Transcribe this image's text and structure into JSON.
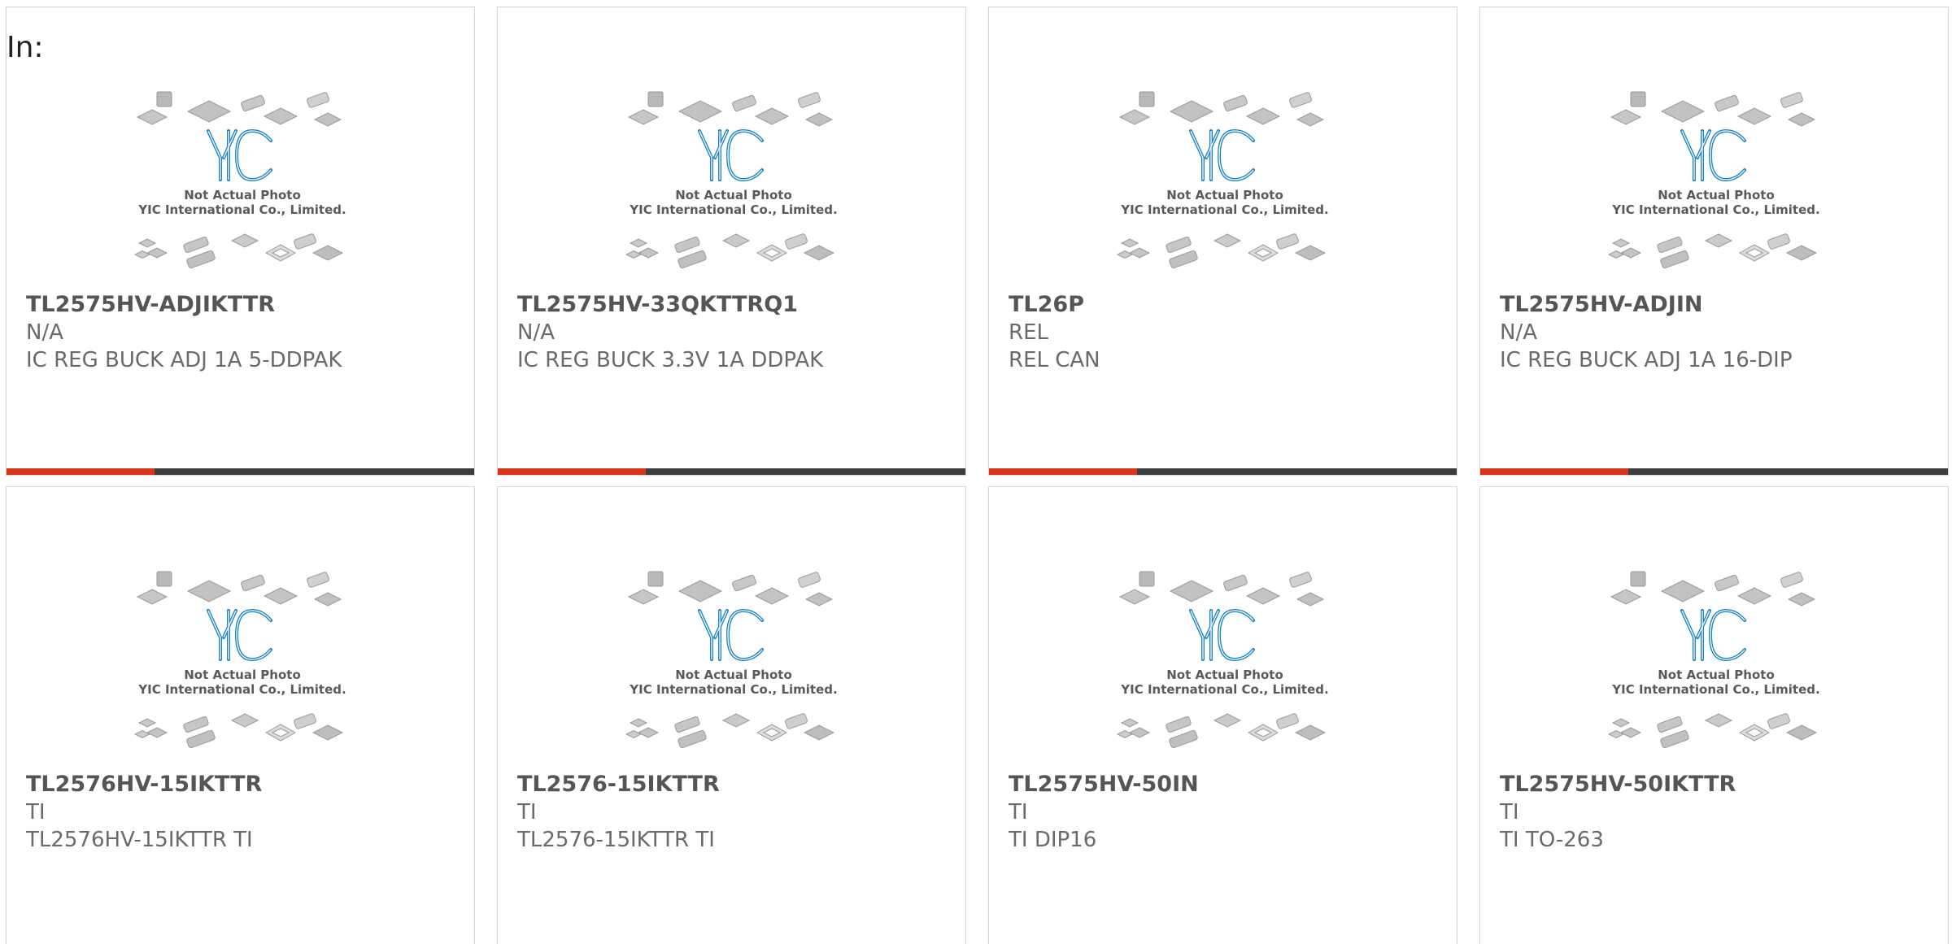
{
  "header": {
    "prefix": "In:"
  },
  "colors": {
    "accent": "#d9331a",
    "bar": "#3d3d3d",
    "logo": "#1a86c8"
  },
  "photo": {
    "caption_line1": "Not Actual Photo",
    "caption_line2": "YIC International Co., Limited."
  },
  "products": [
    {
      "part": "TL2575HV-ADJIKTTR",
      "mfr": "N/A",
      "desc": "IC REG BUCK ADJ 1A 5-DDPAK"
    },
    {
      "part": "TL2575HV-33QKTTRQ1",
      "mfr": "N/A",
      "desc": "IC REG BUCK 3.3V 1A DDPAK"
    },
    {
      "part": "TL26P",
      "mfr": "REL",
      "desc": "REL CAN"
    },
    {
      "part": "TL2575HV-ADJIN",
      "mfr": "N/A",
      "desc": "IC REG BUCK ADJ 1A 16-DIP"
    },
    {
      "part": "TL2576HV-15IKTTR",
      "mfr": "TI",
      "desc": "TL2576HV-15IKTTR TI"
    },
    {
      "part": "TL2576-15IKTTR",
      "mfr": "TI",
      "desc": "TL2576-15IKTTR TI"
    },
    {
      "part": "TL2575HV-50IN",
      "mfr": "TI",
      "desc": "TI DIP16"
    },
    {
      "part": "TL2575HV-50IKTTR",
      "mfr": "TI",
      "desc": "TI TO-263"
    }
  ]
}
